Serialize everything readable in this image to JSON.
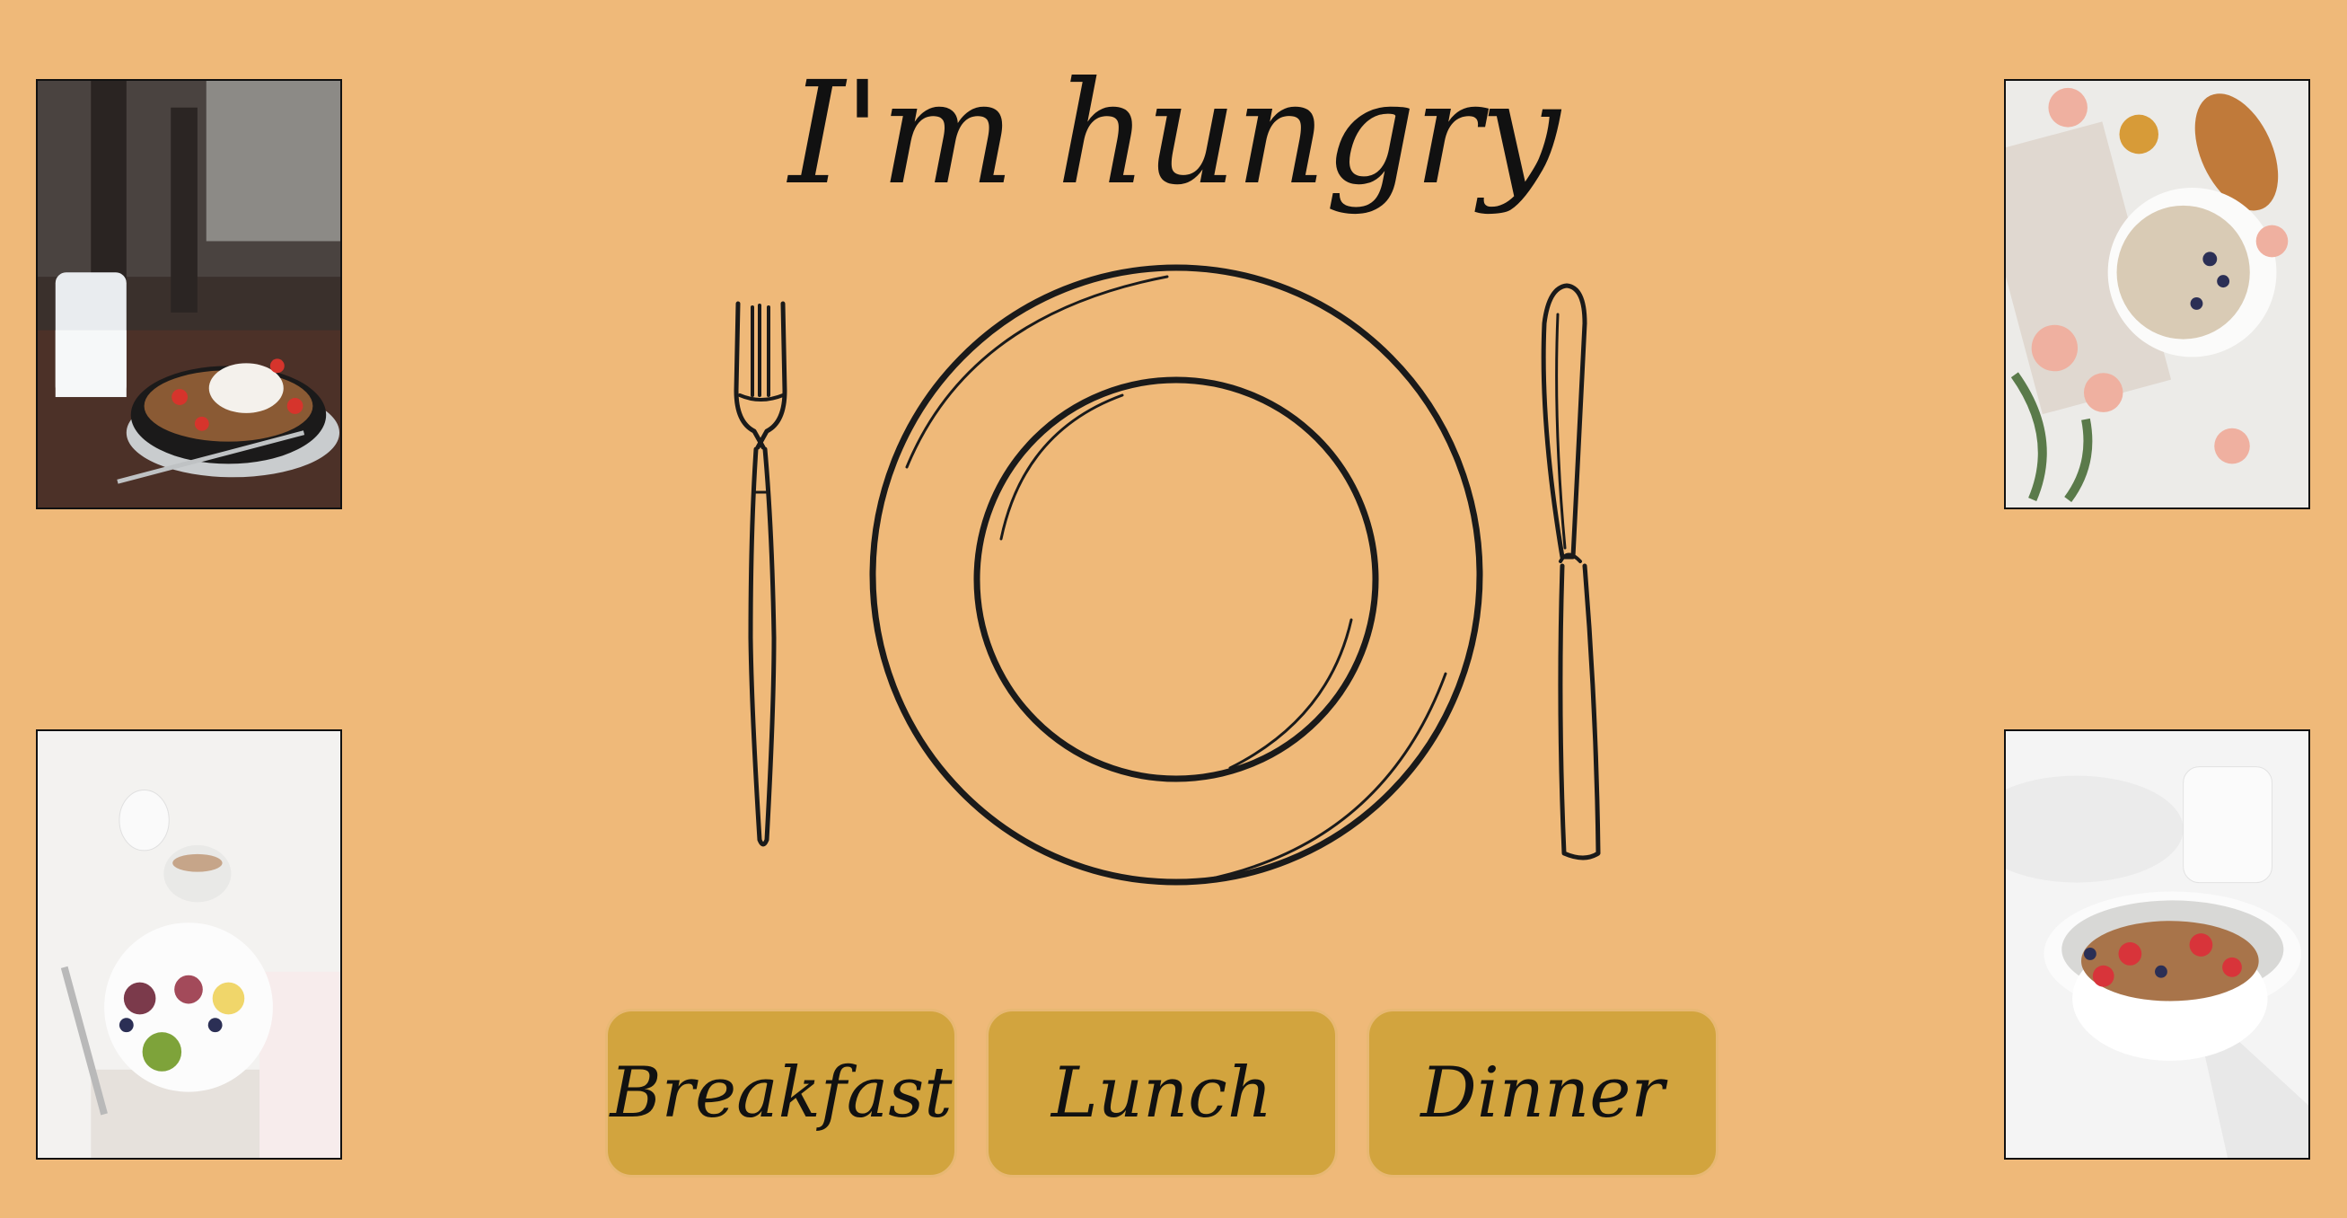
{
  "header": {
    "title": "I'm hungry"
  },
  "photos": [
    {
      "name": "breakfast-granola-berries-photo"
    },
    {
      "name": "oatmeal-croissant-roses-photo"
    },
    {
      "name": "fruit-bowl-coffee-photo"
    },
    {
      "name": "granola-bowl-strawberries-photo"
    }
  ],
  "illustration": {
    "icons": [
      "fork-icon",
      "plate-icon",
      "knife-icon"
    ]
  },
  "buttons": {
    "breakfast": "Breakfast",
    "lunch": "Lunch",
    "dinner": "Dinner"
  },
  "colors": {
    "background": "#efb979",
    "button": "#d2a43e",
    "button_border": "#e8b873",
    "ink": "#111111"
  }
}
